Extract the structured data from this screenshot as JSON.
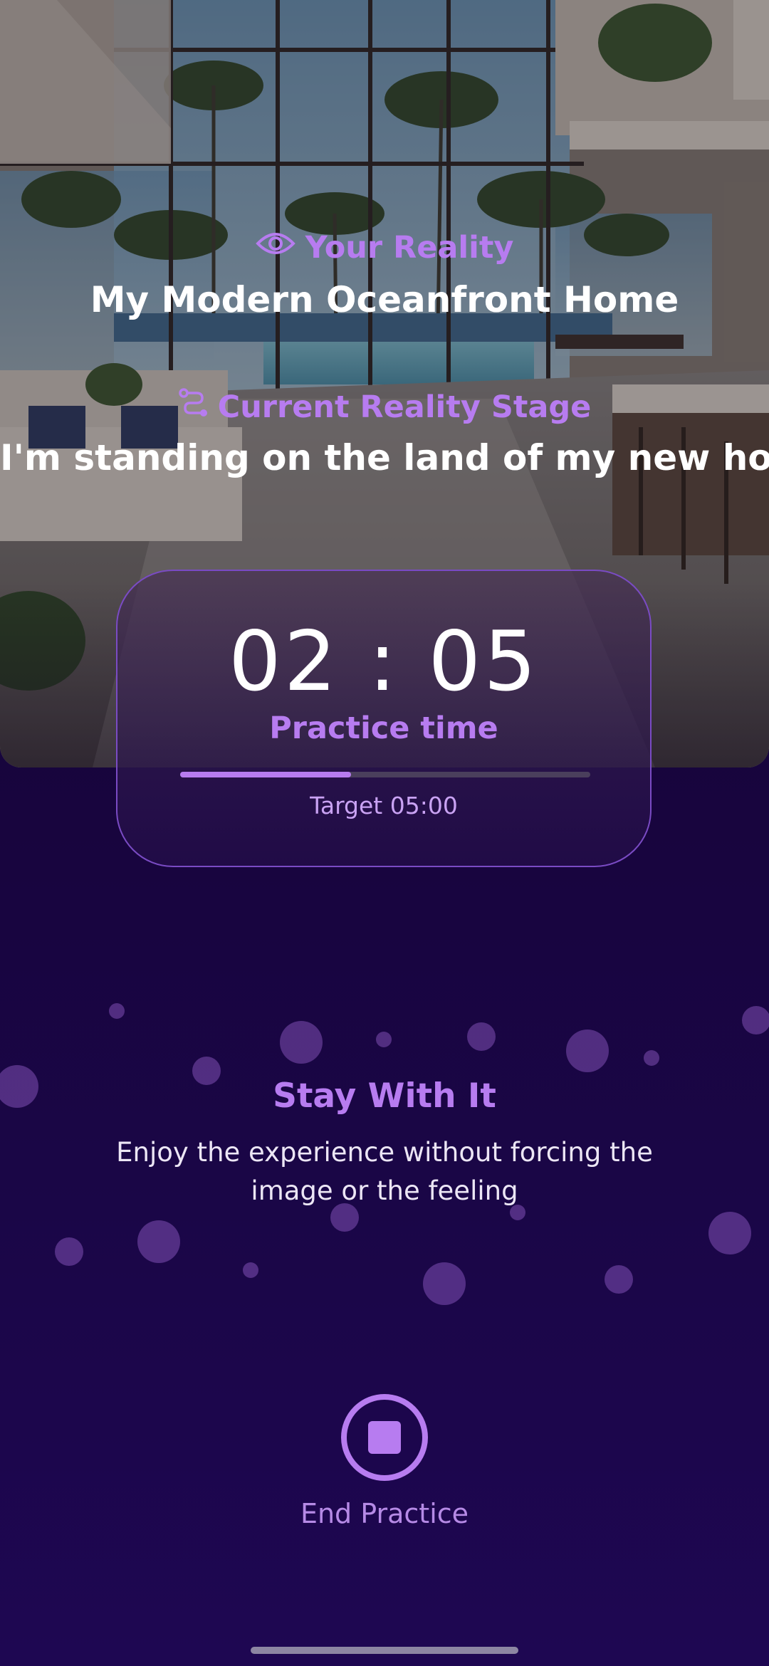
{
  "reality": {
    "label": "Your Reality",
    "title": "My Modern Oceanfront Home",
    "icon": "eye-icon"
  },
  "stage": {
    "label": "Current Reality Stage",
    "text": "I'm standing on the land of my new home",
    "icon": "route-icon"
  },
  "timer": {
    "value": "02 : 05",
    "caption": "Practice time",
    "target_label": "Target 05:00",
    "progress_fraction": 0.417
  },
  "guidance": {
    "title": "Stay With It",
    "subtitle": "Enjoy the experience without forcing the image or the feeling"
  },
  "end_practice": {
    "label": "End Practice",
    "icon": "stop-icon"
  },
  "colors": {
    "accent": "#b77cf0",
    "background": "#1a0640",
    "text": "#ffffff"
  }
}
